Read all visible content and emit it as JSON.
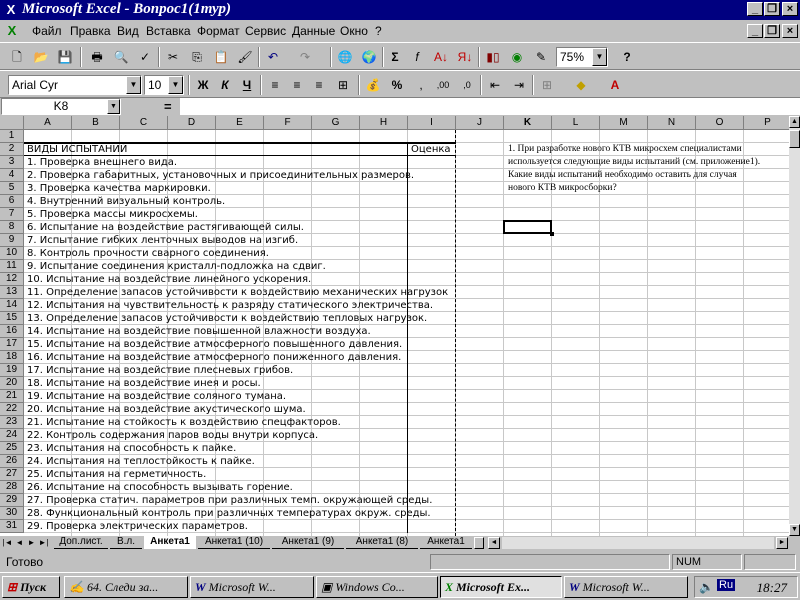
{
  "window": {
    "title": "Microsoft Excel - Вопрос1(1тур)"
  },
  "menu": [
    "Файл",
    "Правка",
    "Вид",
    "Вставка",
    "Формат",
    "Сервис",
    "Данные",
    "Окно",
    "?"
  ],
  "toolbar": {
    "zoom": "75%",
    "font_name": "Arial Cyr",
    "font_size": "10"
  },
  "formula_bar": {
    "name_box": "K8",
    "eq": "=",
    "value": ""
  },
  "columns": [
    "A",
    "B",
    "C",
    "D",
    "E",
    "F",
    "G",
    "H",
    "I",
    "J",
    "K",
    "L",
    "M",
    "N",
    "O",
    "P"
  ],
  "selected_column": "K",
  "rows": [
    "1",
    "2",
    "3",
    "4",
    "5",
    "6",
    "7",
    "8",
    "9",
    "10",
    "11",
    "12",
    "13",
    "14",
    "15",
    "16",
    "17",
    "18",
    "19",
    "20",
    "21",
    "22",
    "23",
    "24",
    "25",
    "26",
    "27",
    "28",
    "29",
    "30",
    "31"
  ],
  "sheet": {
    "header_label": "ВИДЫ ИСПЫТАНИЙ",
    "score_header": "Оценка",
    "items": [
      "1. Проверка внешнего вида.",
      "2. Проверка габаритных, установочных и присоединительных размеров.",
      "3. Проверка качества маркировки.",
      "4. Внутренний визуальный контроль.",
      "5. Проверка массы микросхемы.",
      "6. Испытание на воздействие растягивающей силы.",
      "7. Испытание гибких ленточных выводов на изгиб.",
      "8. Контроль прочности сварного соединения.",
      "9. Испытание соединения кристалл-подложка на сдвиг.",
      "10. Испытание на воздействие линейного ускорения.",
      "11. Определение запасов устойчивости к воздействию механических нагрузок",
      "12. Испытания на чувствительность к разряду статического электричества.",
      "13. Определение запасов устойчивости к воздействию тепловых нагрузок.",
      "14. Испытание на воздействие повышенной влажности воздуха.",
      "15. Испытание на воздействие атмосферного повышенного давления.",
      "16. Испытание на воздействие атмосферного пониженного давления.",
      "17. Испытание на воздействие плесневых грибов.",
      "18. Испытание на воздействие инея и росы.",
      "19. Испытание на воздействие соляного тумана.",
      "20. Испытание на воздействие акустического шума.",
      "21. Испытание на стойкость к воздействию спецфакторов.",
      "22. Контроль содержания паров воды внутри корпуса.",
      "23. Испытания на способность к пайке.",
      "24. Испытания на теплостойкость к пайке.",
      "25. Испытания на герметичность.",
      "26. Испытание на способность вызывать горение.",
      "27. Проверка статич. параметров при различных темп. окружающей среды.",
      "28. Функциональный контроль при различных температурах окруж. среды.",
      "29. Проверка электрических параметров."
    ],
    "note_lines": [
      "1. При разработке нового КТВ микросхем специалистами",
      "используется следующие виды испытаний (см. приложение1).",
      "Какие виды испытаний необходимо оставить для случая",
      "нового КТВ микросборки?"
    ]
  },
  "sheet_tabs": [
    "Доп.лист.",
    "В.л.",
    "Анкета1",
    "Анкета1 (10)",
    "Анкета1 (9)",
    "Анкета1 (8)",
    "Анкета1"
  ],
  "active_tab": "Анкета1",
  "status": {
    "text": "Готово",
    "num": "NUM"
  },
  "taskbar": {
    "start": "Пуск",
    "buttons": [
      "64. Следи за...",
      "Microsoft W...",
      "Windows Co...",
      "Microsoft Ex...",
      "Microsoft W..."
    ],
    "lang": "Ru",
    "clock": "18:27"
  }
}
